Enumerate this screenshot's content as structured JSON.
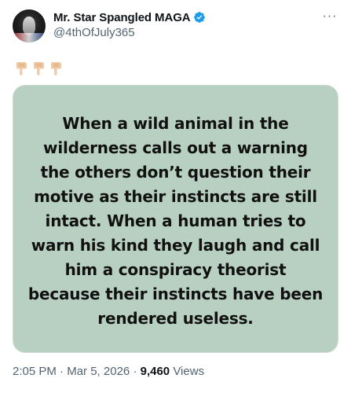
{
  "author": {
    "display_name": "Mr. Star Spangled MAGA",
    "handle": "@4thOfJuly365",
    "verified_color": "#1d9bf0"
  },
  "tweet": {
    "emojis": [
      "pointing-down-hand",
      "pointing-down-hand",
      "pointing-down-hand"
    ],
    "image_text": "When a wild animal in the wilderness calls out a warning the others don’t question their motive as their instincts are still intact.  When a human tries to warn his kind they laugh and call him a conspiracy theorist because their instincts have been rendered useless.",
    "image_background": "#b8d0c1"
  },
  "meta": {
    "time": "2:05 PM",
    "separator": "·",
    "date": "Mar 5, 2026",
    "views_count": "9,460",
    "views_label": "Views"
  },
  "more_label": "···"
}
